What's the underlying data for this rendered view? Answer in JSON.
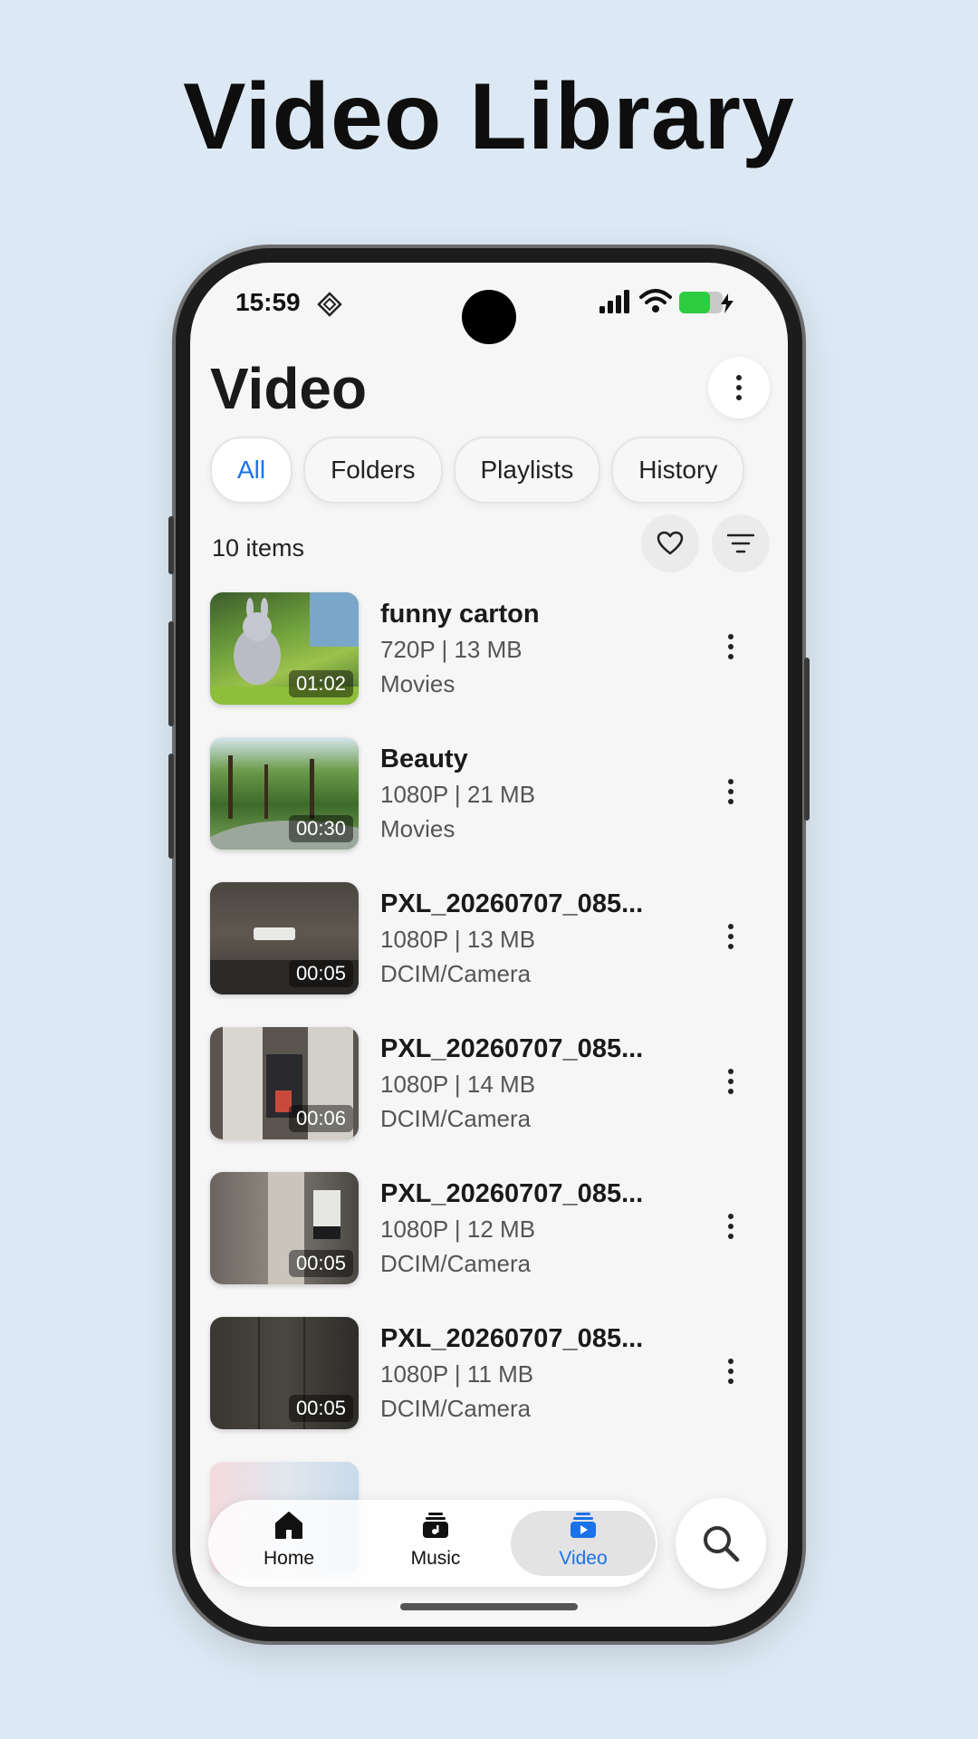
{
  "promo": {
    "title": "Video Library"
  },
  "status_bar": {
    "time": "15:59"
  },
  "header": {
    "title": "Video"
  },
  "tabs": [
    {
      "label": "All",
      "active": true
    },
    {
      "label": "Folders",
      "active": false
    },
    {
      "label": "Playlists",
      "active": false
    },
    {
      "label": "History",
      "active": false
    }
  ],
  "list_header": {
    "count": "10 items"
  },
  "videos": [
    {
      "title": "funny carton",
      "meta": "720P | 13 MB",
      "folder": "Movies",
      "duration": "01:02"
    },
    {
      "title": "Beauty",
      "meta": "1080P | 21 MB",
      "folder": "Movies",
      "duration": "00:30"
    },
    {
      "title": "PXL_20260707_085...",
      "meta": "1080P | 13 MB",
      "folder": "DCIM/Camera",
      "duration": "00:05"
    },
    {
      "title": "PXL_20260707_085...",
      "meta": "1080P | 14 MB",
      "folder": "DCIM/Camera",
      "duration": "00:06"
    },
    {
      "title": "PXL_20260707_085...",
      "meta": "1080P | 12 MB",
      "folder": "DCIM/Camera",
      "duration": "00:05"
    },
    {
      "title": "PXL_20260707_085...",
      "meta": "1080P | 11 MB",
      "folder": "DCIM/Camera",
      "duration": "00:05"
    }
  ],
  "bottom_nav": {
    "items": [
      {
        "label": "Home",
        "icon": "home-icon",
        "active": false
      },
      {
        "label": "Music",
        "icon": "music-icon",
        "active": false
      },
      {
        "label": "Video",
        "icon": "video-icon",
        "active": true
      }
    ]
  },
  "colors": {
    "accent": "#1a73e8",
    "battery": "#2ecc40",
    "background": "#dce8f3"
  }
}
